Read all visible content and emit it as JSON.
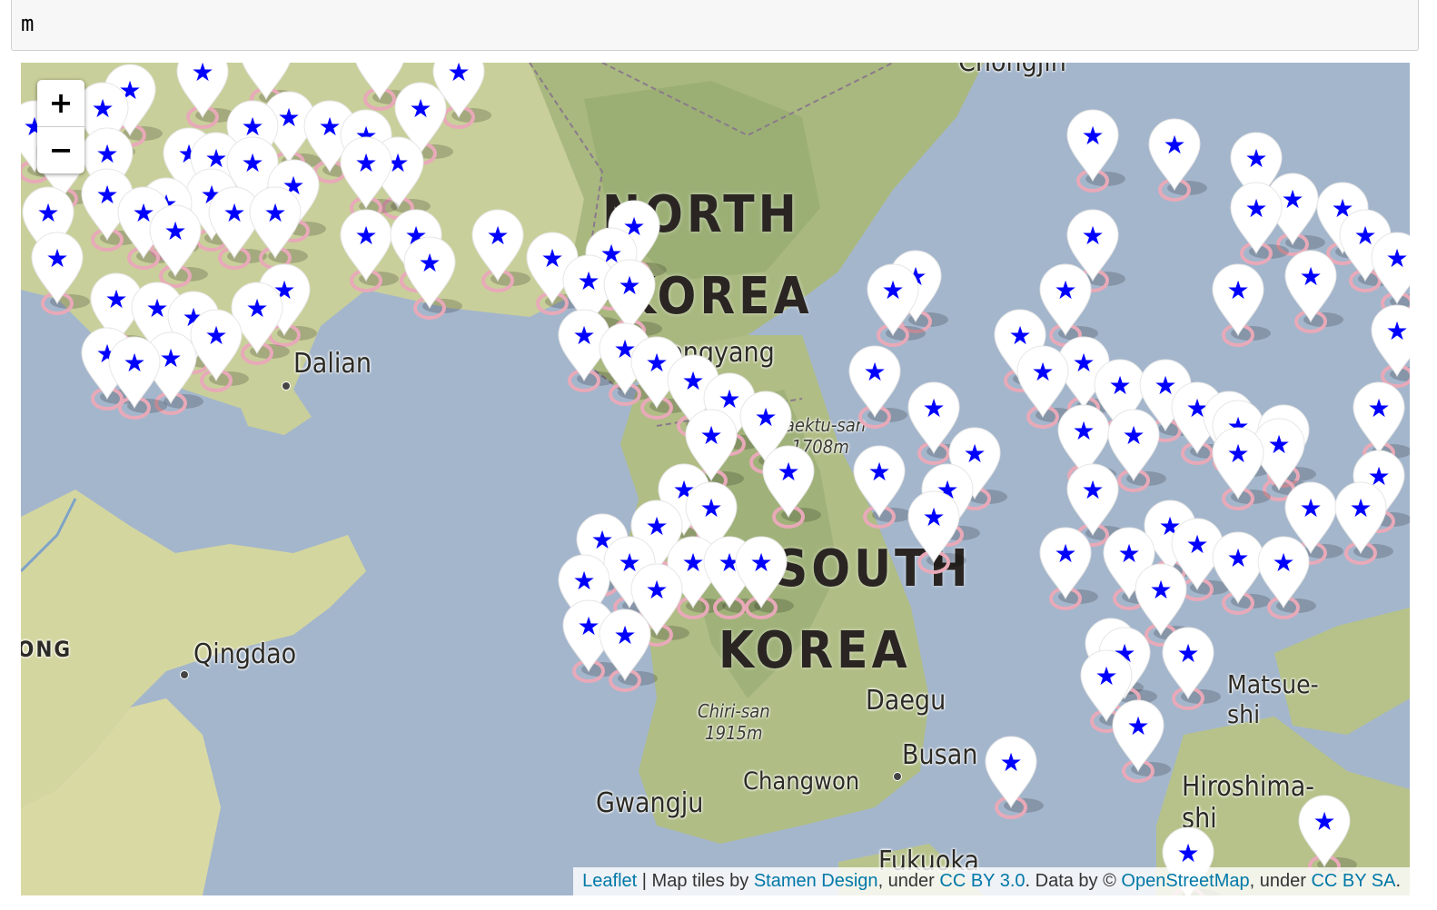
{
  "cell": {
    "input_text": "m"
  },
  "map": {
    "country_labels": [
      {
        "id": "north-korea-line1",
        "text": "NORTH"
      },
      {
        "id": "north-korea-line2",
        "text": "KOREA"
      },
      {
        "id": "south-korea-line1",
        "text": "SOUTH"
      },
      {
        "id": "south-korea-line2",
        "text": "KOREA"
      }
    ],
    "cities": [
      "Dalian",
      "Pyongyang",
      "Qingdao",
      "Daegu",
      "Busan",
      "Changwon",
      "Gwangju",
      "Chongjin",
      "Matsue-shi",
      "Hiroshima-shi",
      "Fukuoka"
    ],
    "peaks": [
      {
        "name": "Chiri-san",
        "elev": "1915m"
      },
      {
        "name": "Paektu-san",
        "elev": "1708m"
      }
    ],
    "edge_label": "ONG",
    "marker_icon": "star-icon",
    "marker_color": "#0000ff",
    "marker_fill": "#ffffff",
    "zoom": {
      "in_label": "+",
      "out_label": "−"
    }
  },
  "attribution": {
    "leaflet": "Leaflet",
    "sep": " | Map tiles by ",
    "stamen": "Stamen Design",
    "under1": ", under ",
    "ccby": "CC BY 3.0",
    "data_by": ". Data by © ",
    "osm": "OpenStreetMap",
    "under2": ", under ",
    "ccbysa": "CC BY SA",
    "end": "."
  }
}
